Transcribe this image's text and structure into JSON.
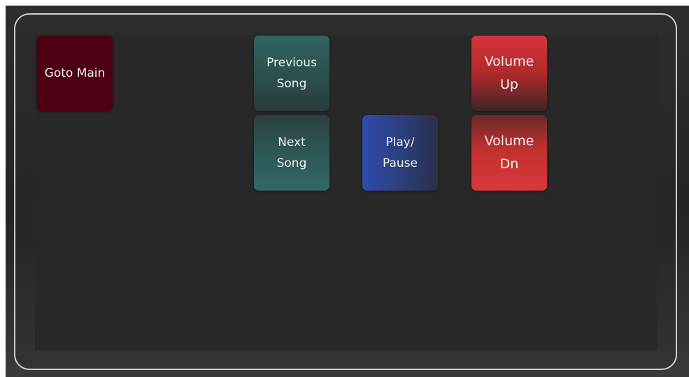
{
  "panel": {
    "buttons": {
      "goto_main": "Goto Main",
      "previous_song": "Previous\nSong",
      "next_song": "Next\nSong",
      "play_pause": "Play/\nPause",
      "volume_up": "Volume\nUp",
      "volume_down": "Volume\nDn"
    }
  },
  "colors": {
    "goto_main": "#4d0013",
    "song_nav": "#2f6462",
    "play_pause": "#2f4cad",
    "volume": "#d6353a",
    "screen": "#282828",
    "frame_border": "#cfcfcf"
  }
}
